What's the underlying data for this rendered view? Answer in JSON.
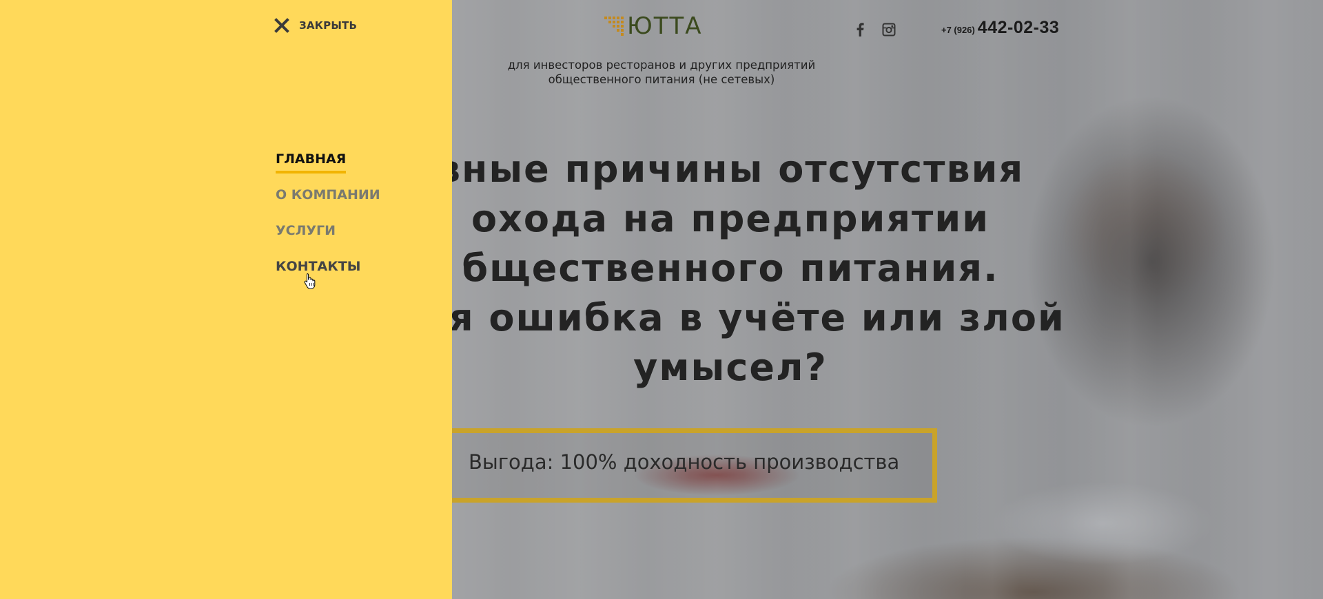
{
  "header": {
    "logo_text": "ЮТТА",
    "tagline_line1": "для инвесторов ресторанов и других предприятий",
    "tagline_line2": "общественного питания (не сетевых)",
    "phone_code": "+7 (926)",
    "phone_number": "442-02-33",
    "social": [
      "facebook-icon",
      "instagram-icon"
    ]
  },
  "hero": {
    "headline_lines": [
      "вные причины отсутствия",
      "охода на предприятии",
      "бщественного питания.",
      "ная ошибка в учёте или злой",
      "умысел?"
    ],
    "benefit_text": "Выгода: 100% доходность производства"
  },
  "menu": {
    "close_label": "ЗАКРЫТЬ",
    "items": [
      {
        "label": "ГЛАВНАЯ",
        "state": "active"
      },
      {
        "label": "О КОМПАНИИ",
        "state": "normal"
      },
      {
        "label": "УСЛУГИ",
        "state": "normal"
      },
      {
        "label": "КОНТАКТЫ",
        "state": "hover"
      }
    ]
  },
  "colors": {
    "menu_background": "#ffd95a",
    "active_underline": "#f2b400",
    "benefit_border": "#c9a32a",
    "logo_green": "#3b4a1e",
    "logo_gold": "#c48a1e"
  }
}
